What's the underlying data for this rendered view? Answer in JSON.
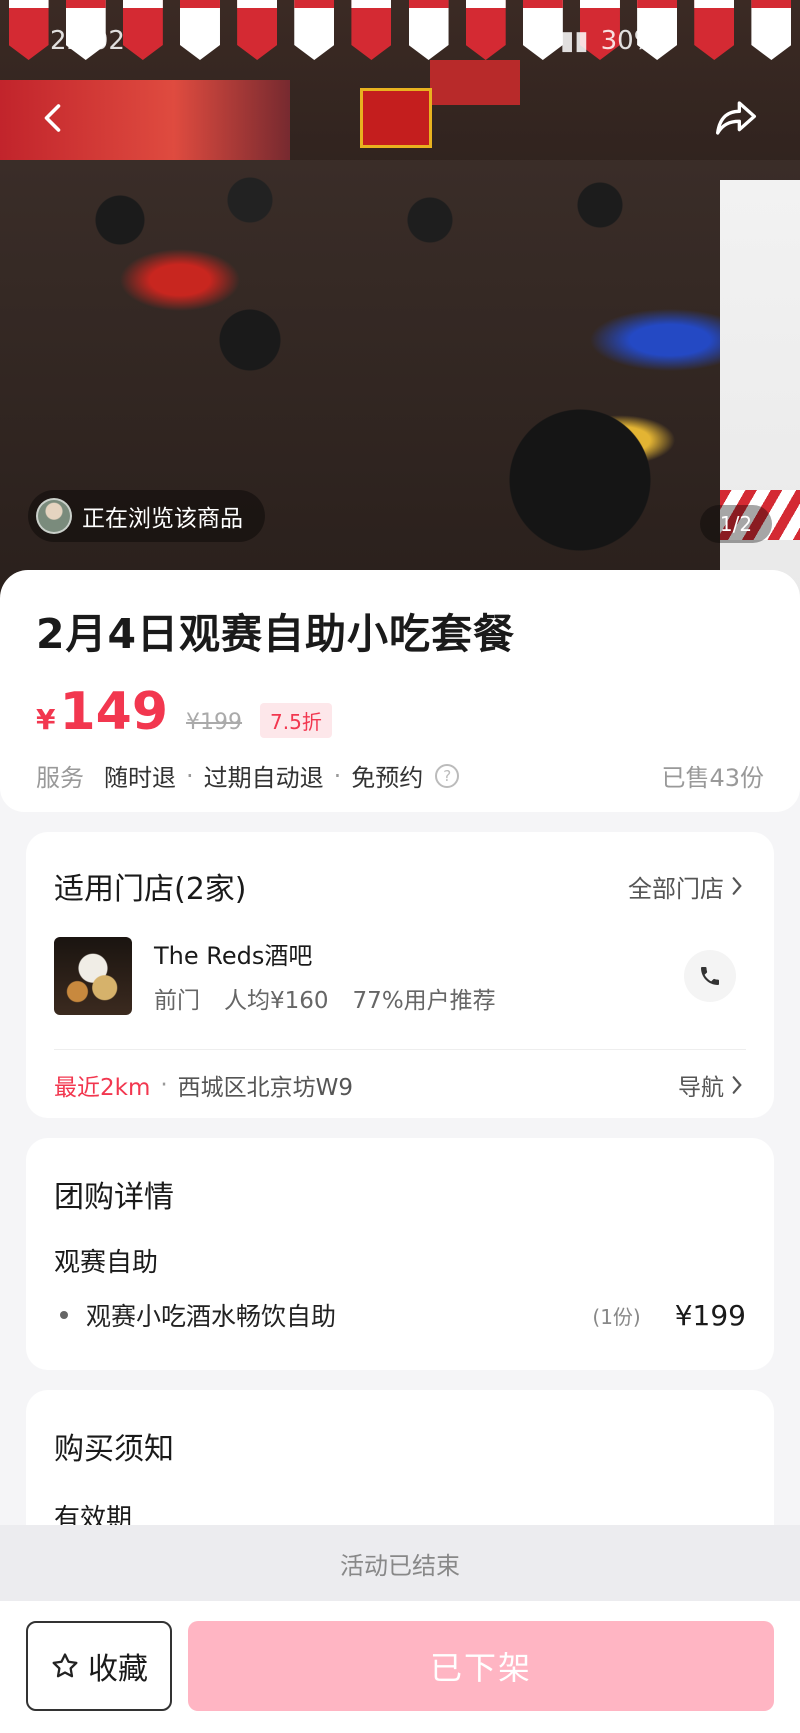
{
  "status_bar": {
    "time": "22:02",
    "battery": "30%"
  },
  "hero": {
    "browsing_text": "正在浏览该商品",
    "pager": "1/2"
  },
  "product": {
    "title": "2月4日观赛自助小吃套餐",
    "currency": "¥",
    "price": "149",
    "original_price": "¥199",
    "discount": "7.5折",
    "service_label": "服务",
    "services": [
      "随时退",
      "过期自动退",
      "免预约"
    ],
    "sold": "已售43份"
  },
  "stores": {
    "title": "适用门店(2家)",
    "all_link": "全部门店",
    "store": {
      "name": "The Reds酒吧",
      "area": "前门",
      "avg": "人均¥160",
      "recommend": "77%用户推荐"
    },
    "distance": "最近2km",
    "address": "西城区北京坊W9",
    "nav_label": "导航"
  },
  "deal": {
    "title": "团购详情",
    "group": "观赛自助",
    "items": [
      {
        "name": "观赛小吃酒水畅饮自助",
        "qty": "(1份)",
        "price": "¥199"
      }
    ]
  },
  "notice": {
    "title": "购买须知",
    "first_section": "有效期"
  },
  "ended_text": "活动已结束",
  "bottom": {
    "favorite_label": "收藏",
    "offline_label": "已下架"
  },
  "colors": {
    "accent": "#f2374f",
    "disabled_button": "#ffb5c3"
  }
}
